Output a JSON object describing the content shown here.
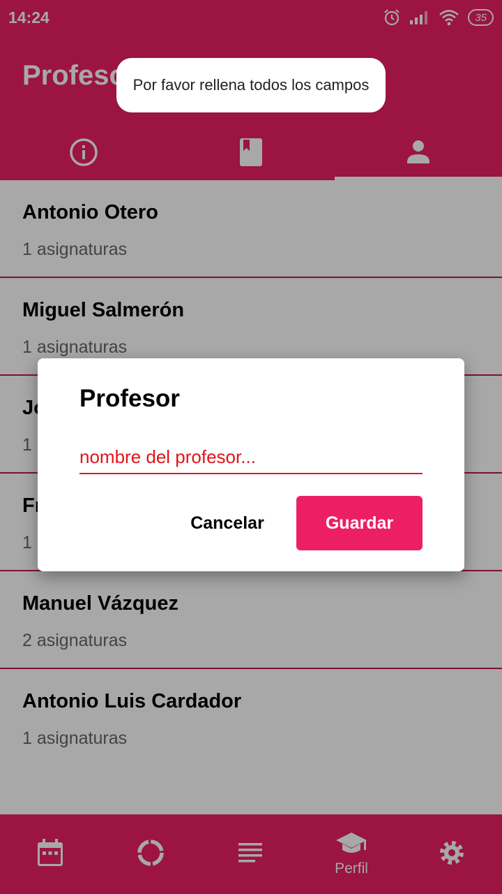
{
  "status_bar": {
    "time": "14:24",
    "battery": "35",
    "icons": [
      "alarm-icon",
      "signal-icon",
      "wifi-icon",
      "battery-icon"
    ]
  },
  "app_bar": {
    "title": "Profesores",
    "tabs": [
      {
        "icon": "info-icon",
        "active": false
      },
      {
        "icon": "book-icon",
        "active": false
      },
      {
        "icon": "person-icon",
        "active": true
      }
    ]
  },
  "teachers": [
    {
      "name": "Antonio Otero",
      "subjects": "1 asignaturas"
    },
    {
      "name": "Miguel Salmerón",
      "subjects": "1 asignaturas"
    },
    {
      "name": "Jo",
      "subjects": "1"
    },
    {
      "name": "Fr",
      "subjects": "1"
    },
    {
      "name": "Manuel Vázquez",
      "subjects": "2 asignaturas"
    },
    {
      "name": "Antonio Luis Cardador",
      "subjects": "1 asignaturas"
    }
  ],
  "bottom_nav": {
    "items": [
      {
        "icon": "calendar-icon",
        "label": ""
      },
      {
        "icon": "progress-ring-icon",
        "label": ""
      },
      {
        "icon": "list-icon",
        "label": ""
      },
      {
        "icon": "school-icon",
        "label": "Perfil"
      },
      {
        "icon": "gear-icon",
        "label": ""
      }
    ]
  },
  "dialog": {
    "title": "Profesor",
    "input_placeholder": "nombre del profesor...",
    "input_value": "",
    "cancel_label": "Cancelar",
    "save_label": "Guardar"
  },
  "toast": {
    "message": "Por favor rellena todos los campos"
  },
  "colors": {
    "primary": "#ec1f65",
    "error": "#e0141a"
  }
}
